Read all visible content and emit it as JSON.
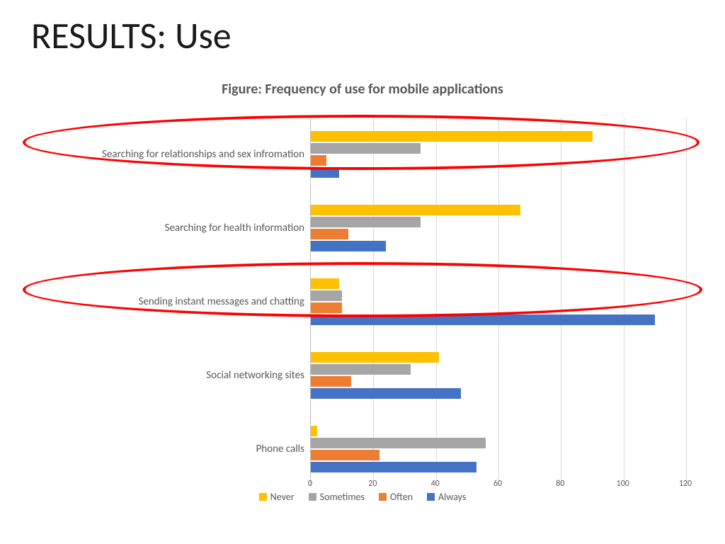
{
  "slide_title": "RESULTS: Use",
  "chart_data": {
    "type": "bar",
    "orientation": "horizontal",
    "grouped": true,
    "title": "Figure: Frequency of use for mobile applications",
    "xlabel": "",
    "ylabel": "",
    "xlim": [
      0,
      120
    ],
    "x_ticks": [
      0,
      20,
      40,
      60,
      80,
      100,
      120
    ],
    "categories": [
      "Searching for relationships and sex infromation",
      "Searching for health information",
      "Sending instant messages and chatting",
      "Social networking sites",
      "Phone calls"
    ],
    "series": [
      {
        "name": "Never",
        "color": "#ffc000",
        "values": [
          90,
          67,
          9,
          41,
          2
        ]
      },
      {
        "name": "Sometimes",
        "color": "#a5a5a5",
        "values": [
          35,
          35,
          10,
          32,
          56
        ]
      },
      {
        "name": "Often",
        "color": "#ed7d31",
        "values": [
          5,
          12,
          10,
          13,
          22
        ]
      },
      {
        "name": "Always",
        "color": "#4472c4",
        "values": [
          9,
          24,
          110,
          48,
          53
        ]
      }
    ],
    "legend_position": "bottom",
    "annotations": {
      "highlighted_categories": [
        "Searching for relationships and sex infromation",
        "Sending instant messages and chatting"
      ],
      "highlight_shape": "ellipse",
      "highlight_color": "#ff0000"
    }
  }
}
